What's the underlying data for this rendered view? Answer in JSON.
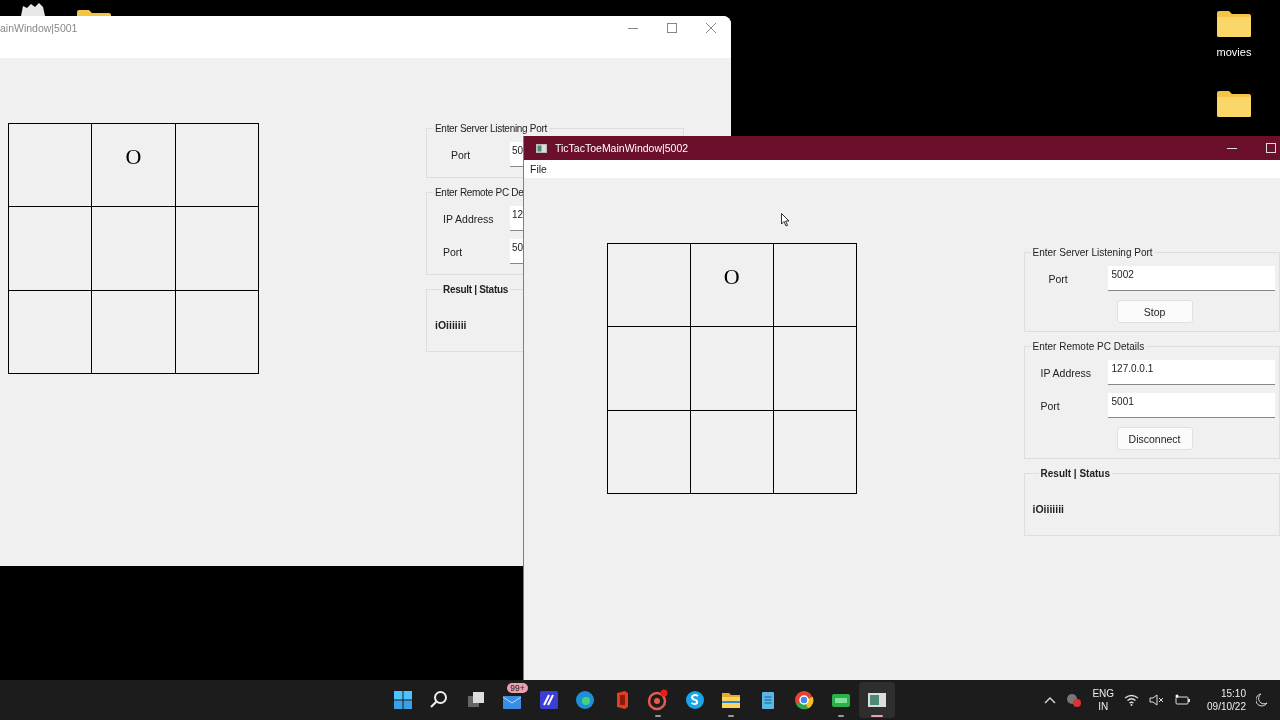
{
  "desktop_icons": [
    {
      "kind": "bin"
    },
    {
      "kind": "folder"
    },
    {
      "kind": "folder",
      "label": "movies"
    },
    {
      "kind": "folder"
    }
  ],
  "windows": [
    {
      "title": "ainWindow|5001",
      "active": false,
      "board": [
        {
          "kind": "empty"
        },
        {
          "kind": "played",
          "mark": "O"
        },
        {
          "kind": "empty"
        },
        {
          "kind": "empty"
        },
        {
          "kind": "empty"
        },
        {
          "kind": "empty"
        },
        {
          "kind": "empty"
        },
        {
          "kind": "empty"
        },
        {
          "kind": "empty"
        }
      ],
      "server_group": {
        "legend": "Enter Server Listening Port",
        "port_label": "Port",
        "port_value": "50"
      },
      "remote_group": {
        "legend": "Enter Remote PC De",
        "ip_label": "IP Address",
        "ip_value": "12",
        "port_label": "Port",
        "port_value": "50"
      },
      "result_group": {
        "heading": "Result | Status",
        "text": "iOiiiiiii"
      }
    },
    {
      "title": "TicTacToeMainWindow|5002",
      "active": true,
      "menu": [
        "File"
      ],
      "board": [
        {
          "kind": "empty"
        },
        {
          "kind": "played",
          "mark": "O"
        },
        {
          "kind": "empty"
        },
        {
          "kind": "empty"
        },
        {
          "kind": "empty"
        },
        {
          "kind": "empty"
        },
        {
          "kind": "empty"
        },
        {
          "kind": "empty"
        },
        {
          "kind": "empty"
        }
      ],
      "server_group": {
        "legend": "Enter Server Listening Port",
        "port_label": "Port",
        "port_value": "5002",
        "button": "Stop"
      },
      "remote_group": {
        "legend": "Enter Remote PC Details",
        "ip_label": "IP Address",
        "ip_value": "127.0.0.1",
        "port_label": "Port",
        "port_value": "5001",
        "button": "Disconnect"
      },
      "result_group": {
        "heading": "Result | Status",
        "text": "iOiiiiiii"
      }
    }
  ],
  "taskbar": {
    "apps": [
      {
        "kind": "start",
        "running": false,
        "selected": false
      },
      {
        "kind": "search",
        "running": false,
        "selected": false
      },
      {
        "kind": "taskview",
        "running": false,
        "selected": false
      },
      {
        "kind": "mail",
        "badge": "99+",
        "running": false,
        "selected": false
      },
      {
        "kind": "editor",
        "running": false,
        "selected": false
      },
      {
        "kind": "edge",
        "running": false,
        "selected": false
      },
      {
        "kind": "office",
        "running": false,
        "selected": false
      },
      {
        "kind": "recorder",
        "running": true,
        "selected": false
      },
      {
        "kind": "skype",
        "running": false,
        "selected": false
      },
      {
        "kind": "explorer",
        "running": true,
        "selected": false
      },
      {
        "kind": "notepad",
        "running": false,
        "selected": false
      },
      {
        "kind": "chrome",
        "running": false,
        "selected": false
      },
      {
        "kind": "qc",
        "running": true,
        "selected": false
      },
      {
        "kind": "app",
        "running": true,
        "selected": true
      }
    ],
    "tray": {
      "language": "ENG",
      "region": "IN",
      "time": "15:10",
      "date": "09/10/22"
    }
  }
}
